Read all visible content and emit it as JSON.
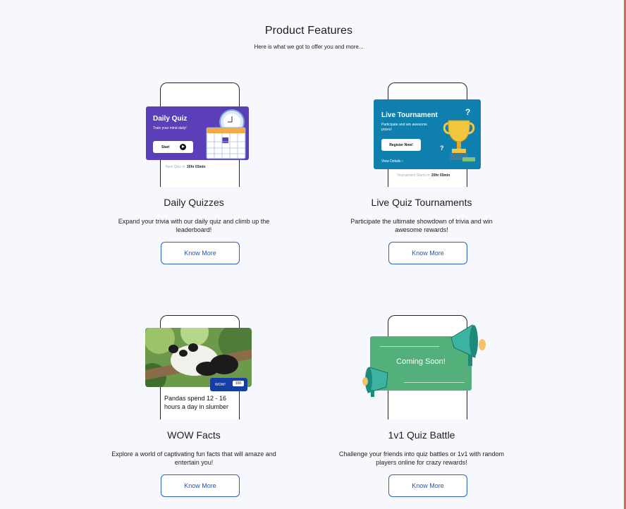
{
  "page": {
    "title": "Product Features",
    "subtitle": "Here is what we got to offer you and more..."
  },
  "features": [
    {
      "title": "Daily Quizzes",
      "description": "Expand your trivia with our daily quiz and climb up the leaderboard!",
      "button_label": "Know More",
      "preview": {
        "banner_title": "Daily Quiz",
        "banner_subtitle": "Train your mind daily!",
        "start_label": "Start",
        "next_quiz_label": "Next Quiz in:",
        "next_quiz_time": "20hr 03min",
        "icons": [
          "clock-icon",
          "calendar-icon",
          "play-icon"
        ]
      }
    },
    {
      "title": "Live Quiz Tournaments",
      "description": "Participate the ultimate showdown of trivia and win awesome rewards!",
      "button_label": "Know More",
      "preview": {
        "banner_title": "Live Tournament",
        "banner_subtitle": "Participate and win awesome prizes!",
        "register_label": "Register Now!",
        "details_label": "View Details",
        "starts_label": "Tournament Starts in:",
        "starts_time": "20hr 03min",
        "icons": [
          "trophy-icon",
          "question-mark-icon",
          "chevron-right-icon"
        ]
      }
    },
    {
      "title": "WOW Facts",
      "description": "Explore a world of captivating fun facts that will amaze and entertain you!",
      "button_label": "Know More",
      "preview": {
        "chip_label": "WOW!",
        "chip_count": "100",
        "fact_text": "Pandas spend 12 - 16 hours a day in slumber",
        "icons": [
          "panda-photo"
        ]
      }
    },
    {
      "title": "1v1 Quiz Battle",
      "description": "Challenge your friends into quiz battles or 1v1 with random players online for crazy rewards!",
      "button_label": "Know More",
      "preview": {
        "banner_text": "Coming Soon!",
        "icons": [
          "megaphone-icon"
        ]
      }
    }
  ],
  "colors": {
    "background": "#f6f8fd",
    "accent": "#1f57b8",
    "daily_quiz": "#5b3fb9",
    "tournament": "#0f80ad",
    "coming_soon": "#53b07a",
    "wow_chip": "#163fa3"
  }
}
